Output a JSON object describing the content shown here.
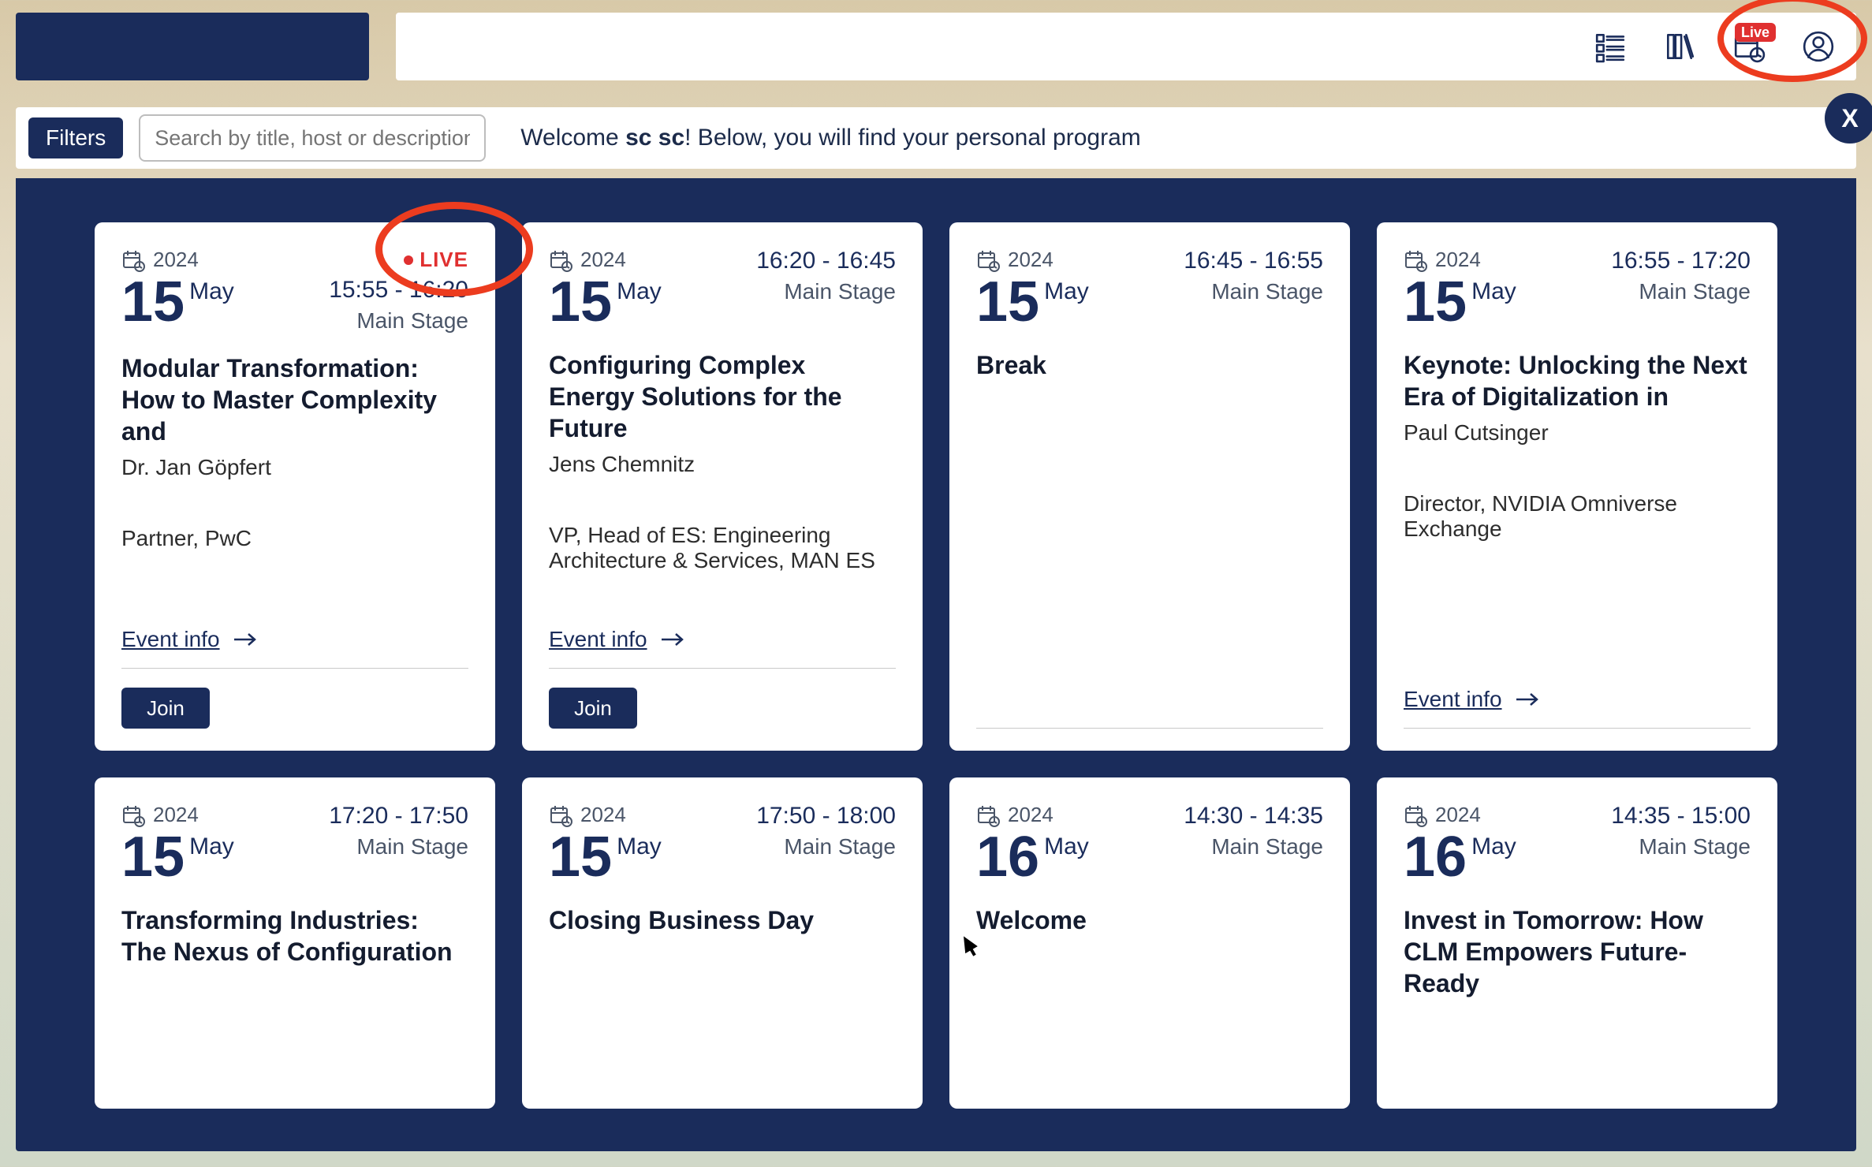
{
  "topbar": {
    "live_badge": "Live"
  },
  "filter": {
    "button": "Filters",
    "search_placeholder": "Search by title, host or description",
    "welcome_prefix": "Welcome ",
    "welcome_user": "sc sc",
    "welcome_suffix": "! Below, you will find your personal program",
    "close": "X"
  },
  "common": {
    "event_info": "Event info",
    "join": "Join"
  },
  "cards": [
    {
      "year": "2024",
      "day": "15",
      "month": "May",
      "live": "LIVE",
      "time": "15:55 - 16:20",
      "loc": "Main Stage",
      "title": "Modular Transformation: How to Master Complexity and",
      "speaker": "Dr. Jan Göpfert",
      "role": "Partner, PwC",
      "hasInfo": true,
      "hasJoin": true
    },
    {
      "year": "2024",
      "day": "15",
      "month": "May",
      "time": "16:20 - 16:45",
      "loc": "Main Stage",
      "title": "Configuring Complex Energy Solutions for the Future",
      "speaker": "Jens Chemnitz",
      "role": "VP, Head of ES: Engineering Architecture & Services, MAN ES",
      "hasInfo": true,
      "hasJoin": true
    },
    {
      "year": "2024",
      "day": "15",
      "month": "May",
      "time": "16:45 - 16:55",
      "loc": "Main Stage",
      "title": "Break"
    },
    {
      "year": "2024",
      "day": "15",
      "month": "May",
      "time": "16:55 - 17:20",
      "loc": "Main Stage",
      "title": "Keynote: Unlocking the Next Era of Digitalization in",
      "speaker": "Paul Cutsinger",
      "role": "Director, NVIDIA Omniverse Exchange",
      "hasInfo": true
    },
    {
      "year": "2024",
      "day": "15",
      "month": "May",
      "time": "17:20 - 17:50",
      "loc": "Main Stage",
      "title": "Transforming Industries: The Nexus of Configuration"
    },
    {
      "year": "2024",
      "day": "15",
      "month": "May",
      "time": "17:50 - 18:00",
      "loc": "Main Stage",
      "title": "Closing Business Day"
    },
    {
      "year": "2024",
      "day": "16",
      "month": "May",
      "time": "14:30 - 14:35",
      "loc": "Main Stage",
      "title": "Welcome"
    },
    {
      "year": "2024",
      "day": "16",
      "month": "May",
      "time": "14:35 - 15:00",
      "loc": "Main Stage",
      "title": "Invest in Tomorrow: How CLM Empowers Future-Ready"
    }
  ]
}
